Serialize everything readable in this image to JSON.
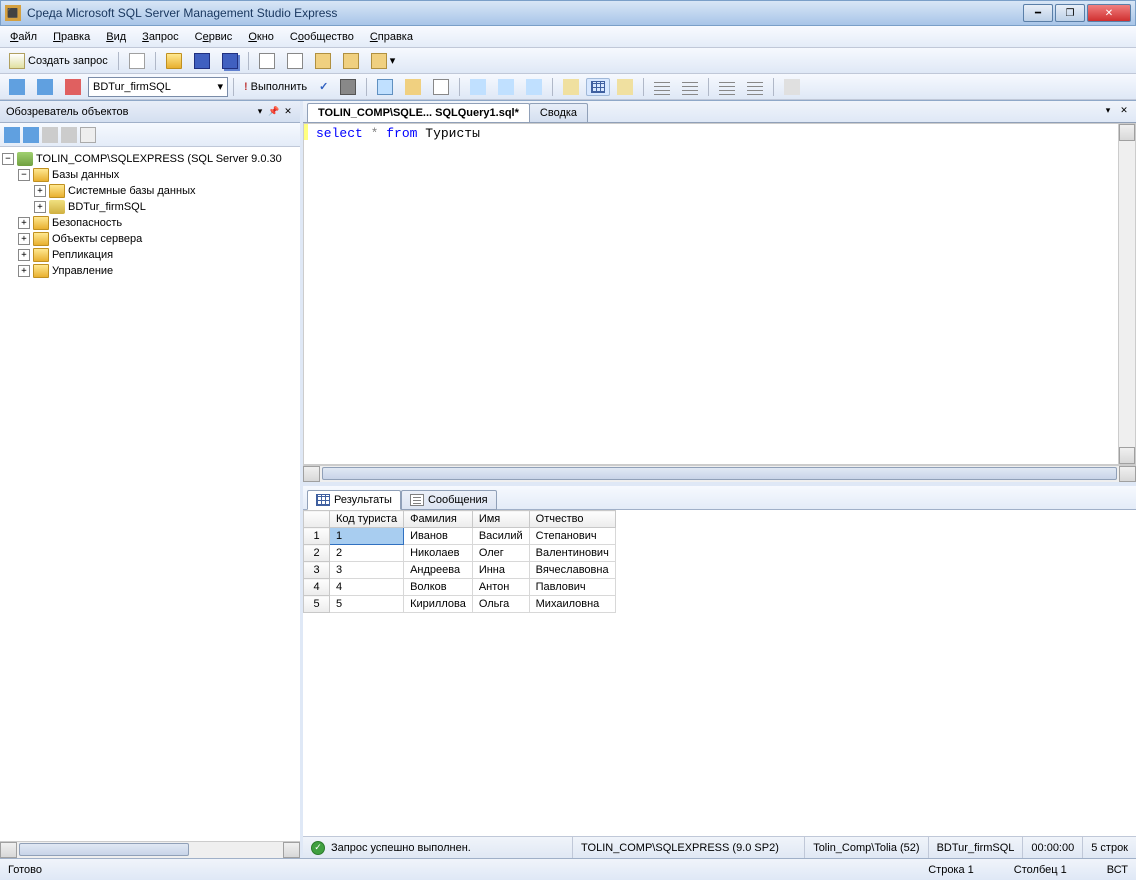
{
  "title": "Среда Microsoft SQL Server Management Studio Express",
  "menu": {
    "file": "Файл",
    "edit": "Правка",
    "view": "Вид",
    "query": "Запрос",
    "service": "Сервис",
    "window": "Окно",
    "community": "Сообщество",
    "help": "Справка"
  },
  "toolbar1": {
    "new_query": "Создать запрос"
  },
  "toolbar2": {
    "database": "BDTur_firmSQL",
    "execute": "Выполнить"
  },
  "object_explorer": {
    "title": "Обозреватель объектов",
    "server": "TOLIN_COMP\\SQLEXPRESS (SQL Server 9.0.30",
    "databases": "Базы данных",
    "sys_db": "Системные базы данных",
    "user_db": "BDTur_firmSQL",
    "security": "Безопасность",
    "server_objects": "Объекты сервера",
    "replication": "Репликация",
    "management": "Управление"
  },
  "editor": {
    "tab1": "TOLIN_COMP\\SQLE... SQLQuery1.sql*",
    "tab2": "Сводка",
    "sql_select": "select",
    "sql_star": "*",
    "sql_from": "from",
    "sql_table": "Туристы"
  },
  "results": {
    "tab_results": "Результаты",
    "tab_messages": "Сообщения",
    "columns": [
      "Код туриста",
      "Фамилия",
      "Имя",
      "Отчество"
    ],
    "rows": [
      [
        "1",
        "Иванов",
        "Василий",
        "Степанович"
      ],
      [
        "2",
        "Николаев",
        "Олег",
        "Валентинович"
      ],
      [
        "3",
        "Андреева",
        "Инна",
        "Вячеславовна"
      ],
      [
        "4",
        "Волков",
        "Антон",
        "Павлович"
      ],
      [
        "5",
        "Кириллова",
        "Ольга",
        "Михаиловна"
      ]
    ]
  },
  "results_status": {
    "message": "Запрос успешно выполнен.",
    "server": "TOLIN_COMP\\SQLEXPRESS (9.0 SP2)",
    "user": "Tolin_Comp\\Tolia (52)",
    "db": "BDTur_firmSQL",
    "time": "00:00:00",
    "rows": "5 строк"
  },
  "statusbar": {
    "ready": "Готово",
    "line": "Строка 1",
    "col": "Столбец 1",
    "ins": "ВСТ"
  }
}
